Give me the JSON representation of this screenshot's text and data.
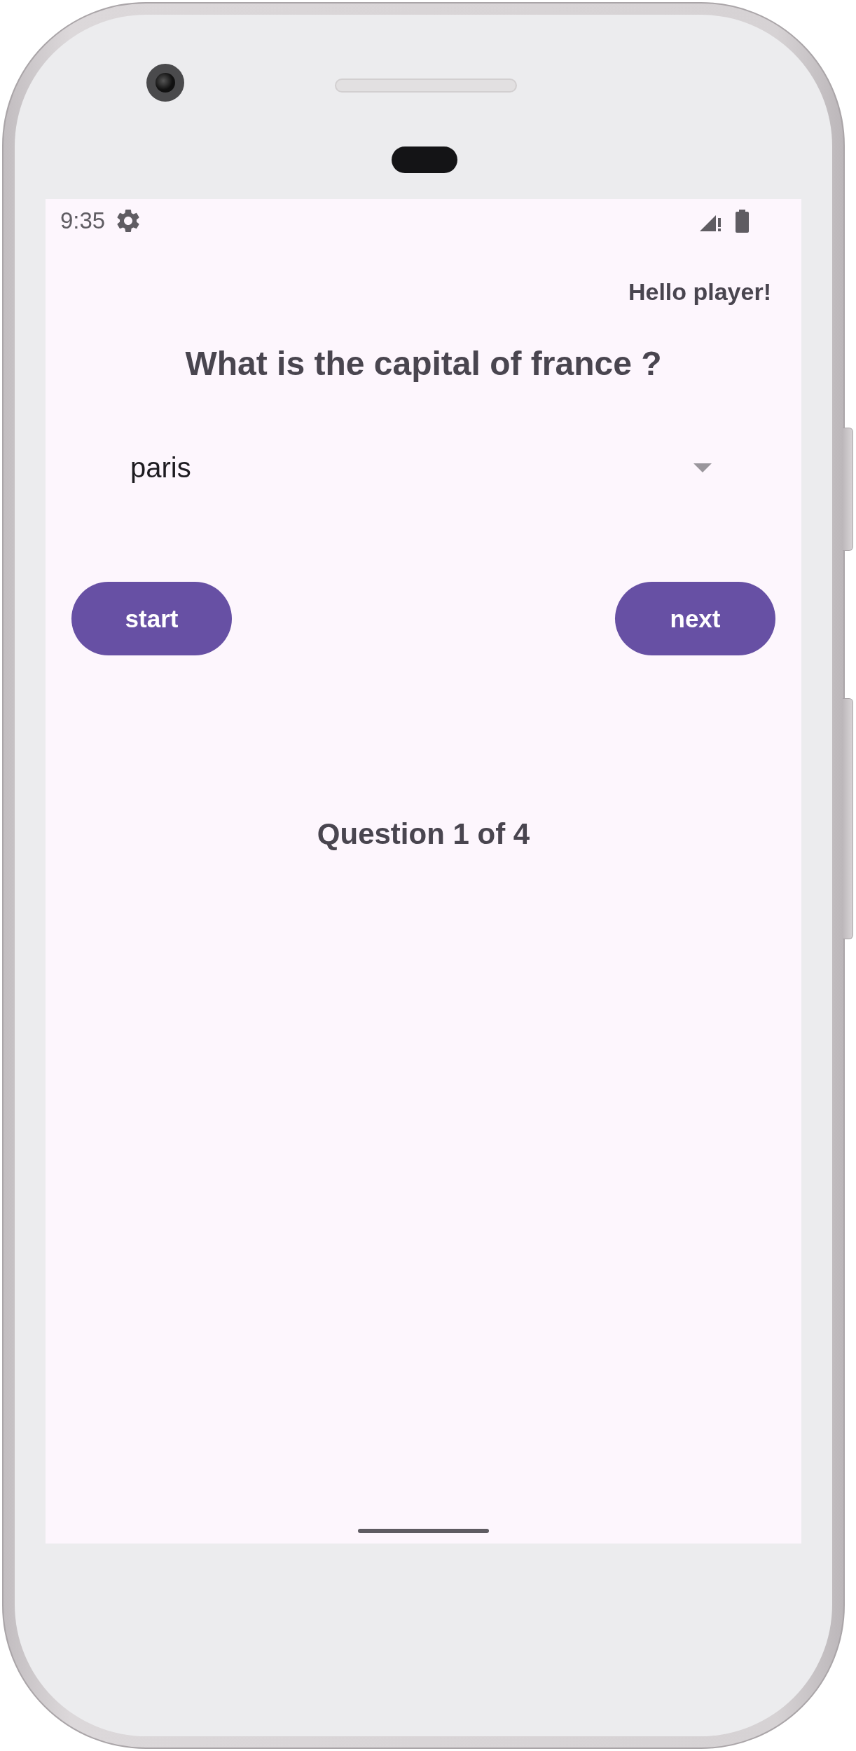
{
  "status_bar": {
    "time": "9:35"
  },
  "greeting": "Hello player!",
  "question": "What is the capital of france ?",
  "answer_dropdown": {
    "value": "paris"
  },
  "buttons": [
    {
      "label": "start"
    },
    {
      "label": "next"
    }
  ],
  "progress": "Question 1 of 4"
}
